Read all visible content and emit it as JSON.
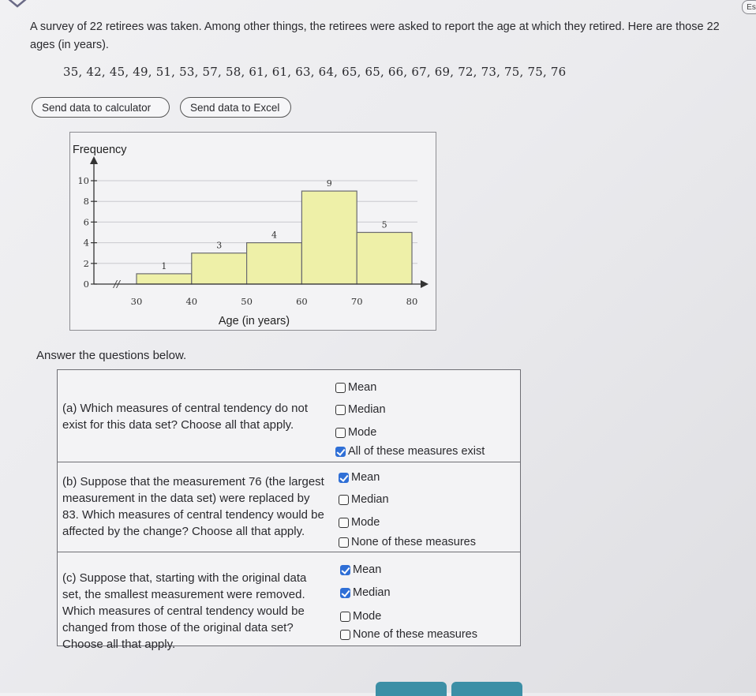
{
  "corner_tab": "Es",
  "intro": {
    "text": "A survey of 22 retirees was taken. Among other things, the retirees were asked to report the age at which they retired. Here are those 22 ages (in years).",
    "data": "35, 42, 45, 49, 51, 53, 57, 58, 61, 61, 63, 64, 65, 65, 66, 67, 69, 72, 73, 75, 75, 76"
  },
  "buttons": {
    "calculator": "Send data to calculator",
    "excel": "Send data to Excel"
  },
  "chart_data": {
    "type": "bar",
    "ylabel": "Frequency",
    "xlabel": "Age (in years)",
    "bins": [
      [
        30,
        40
      ],
      [
        40,
        50
      ],
      [
        50,
        60
      ],
      [
        60,
        70
      ],
      [
        70,
        80
      ]
    ],
    "values": [
      1,
      3,
      4,
      9,
      5
    ],
    "data_labels": [
      "1",
      "3",
      "4",
      "9",
      "5"
    ],
    "x_ticks": [
      "30",
      "40",
      "50",
      "60",
      "70",
      "80"
    ],
    "y_ticks": [
      "0",
      "2",
      "4",
      "6",
      "8",
      "10"
    ],
    "ylim": [
      0,
      10
    ],
    "axis_break": true,
    "grid": true,
    "bar_color": "#eef0a8"
  },
  "answer_title": "Answer the questions below.",
  "questions": [
    {
      "text": "(a) Which measures of central tendency do not exist for this data set? Choose all that apply.",
      "options": [
        {
          "label": "Mean",
          "checked": false
        },
        {
          "label": "Median",
          "checked": false
        },
        {
          "label": "Mode",
          "checked": false
        },
        {
          "label": "All of these measures exist",
          "checked": true
        }
      ]
    },
    {
      "text": "(b) Suppose that the measurement 76 (the largest measurement in the data set) were replaced by 83. Which measures of central tendency would be affected by the change? Choose all that apply.",
      "options": [
        {
          "label": "Mean",
          "checked": true
        },
        {
          "label": "Median",
          "checked": false
        },
        {
          "label": "Mode",
          "checked": false
        },
        {
          "label": "None of these measures",
          "checked": false
        }
      ]
    },
    {
      "text": "(c) Suppose that, starting with the original data set, the smallest measurement were removed. Which measures of central tendency would be changed from those of the original data set? Choose all that apply.",
      "options": [
        {
          "label": "Mean",
          "checked": true
        },
        {
          "label": "Median",
          "checked": true
        },
        {
          "label": "Mode",
          "checked": false
        },
        {
          "label": "None of these measures",
          "checked": false
        }
      ]
    }
  ],
  "colors": {
    "checked": "#2f6fd6",
    "bottom_button": "#3c8fa6"
  }
}
